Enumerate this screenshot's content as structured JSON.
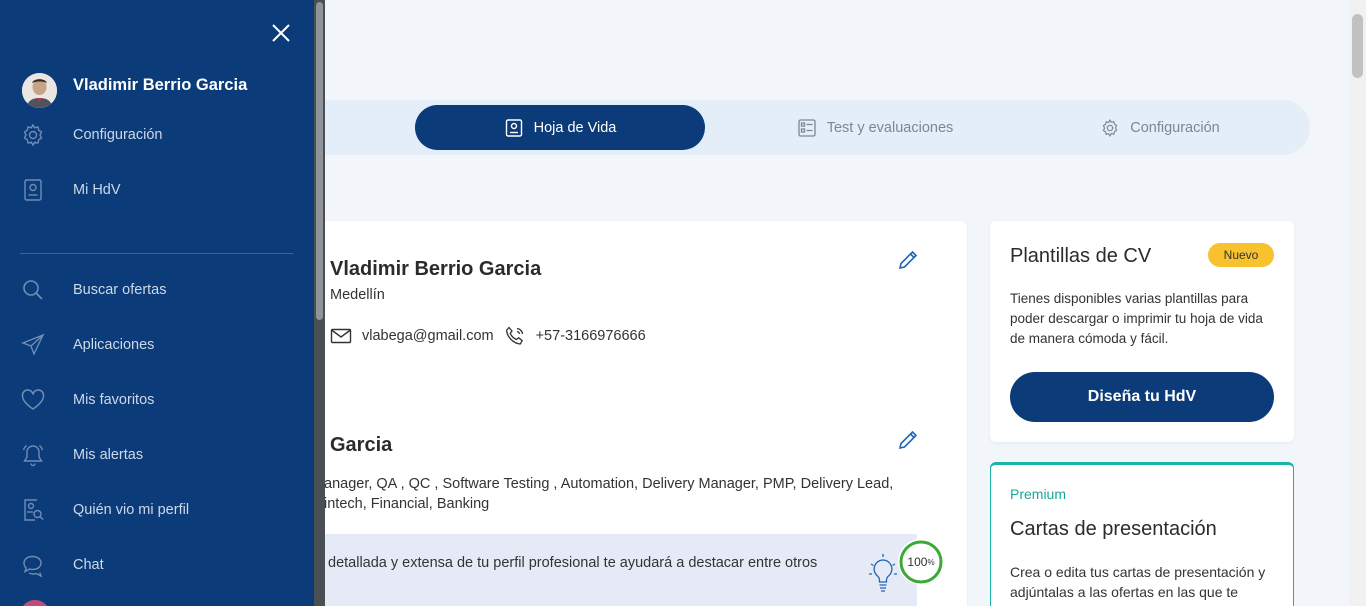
{
  "sidebar": {
    "user_name": "Vladimir Berrio Garcia",
    "items_top": [
      {
        "label": "Configuración",
        "icon": "gear-icon"
      },
      {
        "label": "Mi HdV",
        "icon": "id-card-icon"
      }
    ],
    "items": [
      {
        "label": "Buscar ofertas",
        "icon": "search-icon"
      },
      {
        "label": "Aplicaciones",
        "icon": "send-icon"
      },
      {
        "label": "Mis favoritos",
        "icon": "heart-icon"
      },
      {
        "label": "Mis alertas",
        "icon": "bell-icon"
      },
      {
        "label": "Quién vio mi perfil",
        "icon": "profile-search-icon"
      },
      {
        "label": "Chat",
        "icon": "chat-icon"
      }
    ]
  },
  "tabs": [
    {
      "label": "Hoja de Vida",
      "active": true,
      "icon": "id-card-icon"
    },
    {
      "label": "Test y evaluaciones",
      "active": false,
      "icon": "checklist-icon"
    },
    {
      "label": "Configuración",
      "active": false,
      "icon": "gear-icon"
    }
  ],
  "profile": {
    "name": "Vladimir Berrio Garcia",
    "city": "Medellín",
    "email": "vlabega@gmail.com",
    "phone": "+57-3166976666",
    "section_title": "Garcia",
    "skills_line1": "anager, QA , QC , Software Testing , Automation, Delivery Manager, PMP, Delivery Lead,",
    "skills_line2": "intech, Financial, Banking",
    "tip": "detallada y extensa de tu perfil profesional te ayudará a destacar entre otros",
    "completion_value": "100",
    "completion_unit": "%",
    "completion_fraction": 1.0
  },
  "cv_templates": {
    "title": "Plantillas de CV",
    "badge": "Nuevo",
    "description": "Tienes disponibles varias plantillas para poder descargar o imprimir tu hoja de vida de manera cómoda y fácil.",
    "cta": "Diseña tu HdV"
  },
  "cover_letters": {
    "tier": "Premium",
    "title": "Cartas de presentación",
    "description": "Crea o edita tus cartas de presentación y adjúntalas a las ofertas en las que te"
  },
  "colors": {
    "navy": "#0b3b78",
    "badge_yellow": "#f8c22f",
    "teal": "#19b5a6",
    "progress_green": "#3aaa35"
  }
}
